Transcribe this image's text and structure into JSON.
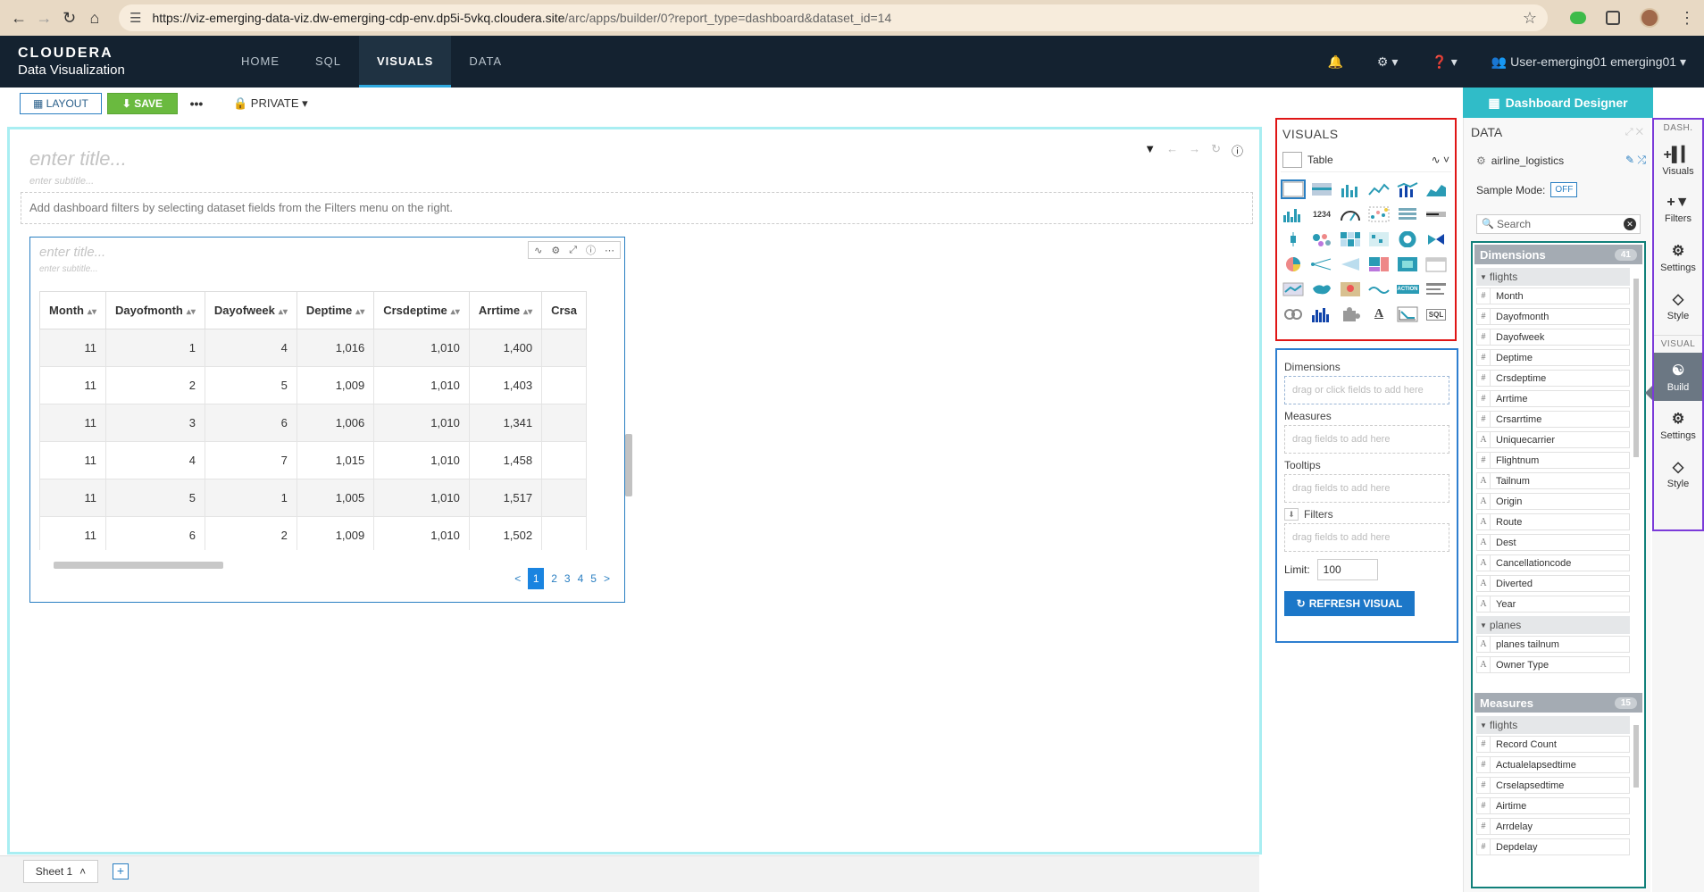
{
  "browser": {
    "url_host": "https://viz-emerging-data-viz.dw-emerging-cdp-env.dp5i-5vkq.cloudera.site",
    "url_path": "/arc/apps/builder/0?report_type=dashboard&dataset_id=14"
  },
  "app": {
    "brand": "CLOUDERA",
    "product": "Data Visualization",
    "nav": [
      "HOME",
      "SQL",
      "VISUALS",
      "DATA"
    ],
    "user": "User-emerging01 emerging01"
  },
  "toolbar": {
    "layout_label": "LAYOUT",
    "save_label": "SAVE",
    "more_label": "•••",
    "private_label": "PRIVATE"
  },
  "dashboard": {
    "title_placeholder": "enter title...",
    "subtitle_placeholder": "enter subtitle...",
    "filter_hint": "Add dashboard filters by selecting dataset fields from the Filters menu on the right."
  },
  "visual": {
    "title_placeholder": "enter title...",
    "subtitle_placeholder": "enter subtitle...",
    "columns": [
      "Month",
      "Dayofmonth",
      "Dayofweek",
      "Deptime",
      "Crsdeptime",
      "Arrtime",
      "Crsa"
    ],
    "rows": [
      [
        "11",
        "1",
        "4",
        "1,016",
        "1,010",
        "1,400"
      ],
      [
        "11",
        "2",
        "5",
        "1,009",
        "1,010",
        "1,403"
      ],
      [
        "11",
        "3",
        "6",
        "1,006",
        "1,010",
        "1,341"
      ],
      [
        "11",
        "4",
        "7",
        "1,015",
        "1,010",
        "1,458"
      ],
      [
        "11",
        "5",
        "1",
        "1,005",
        "1,010",
        "1,517"
      ],
      [
        "11",
        "6",
        "2",
        "1,009",
        "1,010",
        "1,502"
      ]
    ],
    "pages": [
      "1",
      "2",
      "3",
      "4",
      "5"
    ],
    "prev": "<",
    "next": ">"
  },
  "sheets": {
    "tab_label": "Sheet 1",
    "add_label": "+"
  },
  "visuals_panel": {
    "header": "VISUALS",
    "selected_type": "Table",
    "kpi_text": "1234",
    "action_text": "ACTION",
    "text_text": "A",
    "sql_text": "SQL"
  },
  "shelves": {
    "dimensions_label": "Dimensions",
    "dimensions_placeholder": "drag or click fields to add here",
    "measures_label": "Measures",
    "measures_placeholder": "drag fields to add here",
    "tooltips_label": "Tooltips",
    "tooltips_placeholder": "drag fields to add here",
    "filters_label": "Filters",
    "filters_placeholder": "drag fields to add here",
    "limit_label": "Limit:",
    "limit_value": "100",
    "refresh_label": "REFRESH VISUAL"
  },
  "data_panel": {
    "designer_label": "Dashboard Designer",
    "header": "DATA",
    "dataset": "airline_logistics",
    "sample_mode_label": "Sample Mode:",
    "sample_mode_value": "OFF",
    "search_placeholder": "Search",
    "dimensions_label": "Dimensions",
    "dimensions_count": "41",
    "measures_label": "Measures",
    "measures_count": "15",
    "dim_groups": [
      {
        "name": "flights",
        "fields": [
          {
            "type": "#",
            "name": "Month"
          },
          {
            "type": "#",
            "name": "Dayofmonth"
          },
          {
            "type": "#",
            "name": "Dayofweek"
          },
          {
            "type": "#",
            "name": "Deptime"
          },
          {
            "type": "#",
            "name": "Crsdeptime"
          },
          {
            "type": "#",
            "name": "Arrtime"
          },
          {
            "type": "#",
            "name": "Crsarrtime"
          },
          {
            "type": "A",
            "name": "Uniquecarrier"
          },
          {
            "type": "#",
            "name": "Flightnum"
          },
          {
            "type": "A",
            "name": "Tailnum"
          },
          {
            "type": "A",
            "name": "Origin"
          },
          {
            "type": "A",
            "name": "Route"
          },
          {
            "type": "A",
            "name": "Dest"
          },
          {
            "type": "A",
            "name": "Cancellationcode"
          },
          {
            "type": "A",
            "name": "Diverted"
          },
          {
            "type": "A",
            "name": "Year"
          }
        ]
      },
      {
        "name": "planes",
        "fields": [
          {
            "type": "A",
            "name": "planes tailnum"
          },
          {
            "type": "A",
            "name": "Owner Type"
          }
        ]
      }
    ],
    "meas_groups": [
      {
        "name": "flights",
        "fields": [
          {
            "type": "#",
            "name": "Record Count"
          },
          {
            "type": "#",
            "name": "Actualelapsedtime"
          },
          {
            "type": "#",
            "name": "Crselapsedtime"
          },
          {
            "type": "#",
            "name": "Airtime"
          },
          {
            "type": "#",
            "name": "Arrdelay"
          },
          {
            "type": "#",
            "name": "Depdelay"
          }
        ]
      }
    ]
  },
  "rail": {
    "dash_label": "DASH.",
    "visual_label": "VISUAL",
    "items_dash": [
      "Visuals",
      "Filters",
      "Settings",
      "Style"
    ],
    "items_visual": [
      "Build",
      "Settings",
      "Style"
    ]
  },
  "colors": {
    "accent": "#2a7fc2",
    "header_bg": "#142230",
    "designer_bg": "#30bcc8",
    "save_green": "#6aba3f"
  }
}
